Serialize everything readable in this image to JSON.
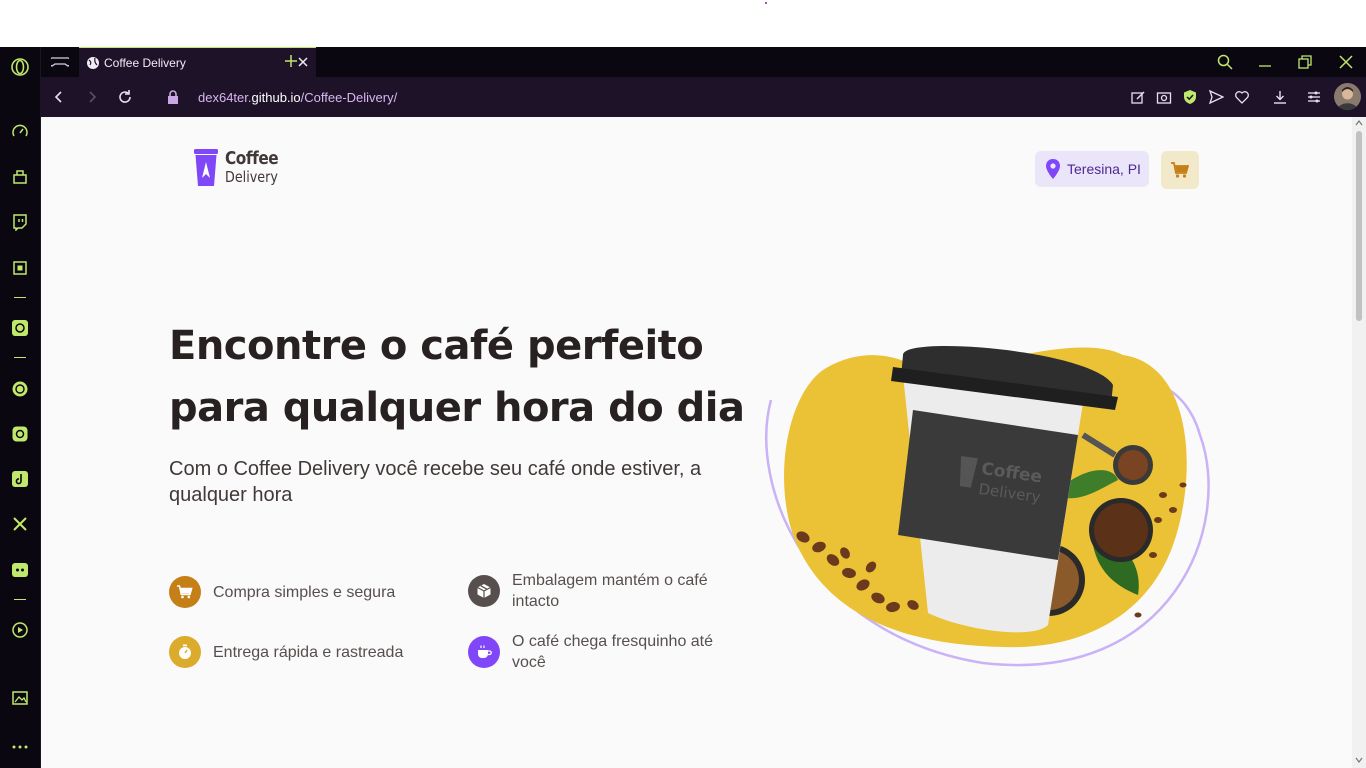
{
  "browser": {
    "tab_title": "Coffee Delivery",
    "url_prefix": "dex64ter.",
    "url_host": "github.io",
    "url_path": "/Coffee-Delivery/"
  },
  "header": {
    "logo_line1": "Coffee",
    "logo_line2": "Delivery",
    "location": "Teresina, PI"
  },
  "hero": {
    "title": "Encontre o café perfeito para qualquer hora do dia",
    "subtitle": "Com o Coffee Delivery você recebe seu café onde estiver, a qualquer hora",
    "features": [
      {
        "label": "Compra simples e segura",
        "icon": "cart-icon",
        "color": "#C47F17"
      },
      {
        "label": "Embalagem mantém o café intacto",
        "icon": "package-icon",
        "color": "#574F4D"
      },
      {
        "label": "Entrega rápida e rastreada",
        "icon": "timer-icon",
        "color": "#DBAC2C"
      },
      {
        "label": "O café chega fresquinho até você",
        "icon": "coffee-icon",
        "color": "#8047F8"
      }
    ],
    "cup_logo_line1": "Coffee",
    "cup_logo_line2": "Delivery"
  },
  "colors": {
    "brand_purple": "#8047F8",
    "yellow": "#DBAC2C",
    "sidebar_accent": "#BFE86C"
  }
}
